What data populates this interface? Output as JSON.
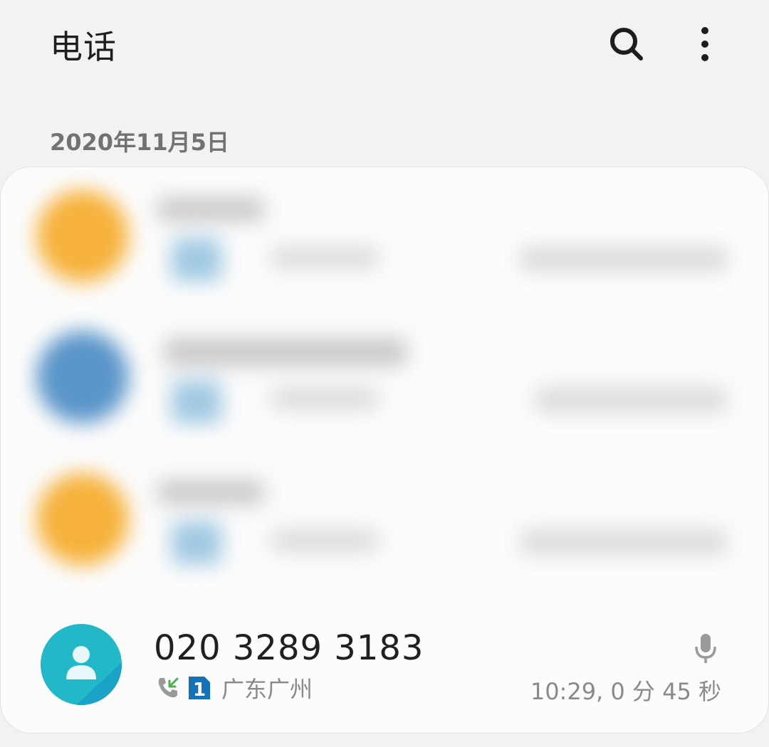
{
  "app": {
    "title": "电话"
  },
  "icons": {
    "search": "search-icon",
    "more": "more-vertical-icon",
    "mic": "microphone-icon",
    "incoming": "incoming-call-icon",
    "sim": "sim-1-icon",
    "avatar": "person-icon"
  },
  "colors": {
    "avatar_blurred_1": "#f6b23c",
    "avatar_blurred_2": "#5a95c9",
    "avatar_blurred_3": "#f6b23c",
    "avatar_contact": "#21b8c8",
    "incoming_arrow": "#4caf50",
    "sim_badge": "#1473b8"
  },
  "log": {
    "date_header": "2020年11月5日",
    "entries": [
      {
        "number": "020 3289 3183",
        "sim": "1",
        "location": "广东广州",
        "time": "10:29, 0 分 45 秒"
      }
    ]
  }
}
